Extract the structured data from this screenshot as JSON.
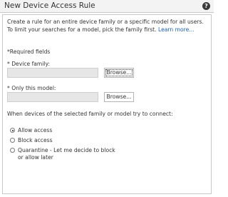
{
  "window": {
    "title": "New Device Access Rule"
  },
  "intro": {
    "text": "Create a rule for an entire device family or a specific model for all users. To limit your searches for a model, pick the family first.",
    "link_text": "Learn more..."
  },
  "form": {
    "required_note": "*Required fields",
    "device_family_label": "* Device family:",
    "device_family_value": "",
    "only_model_label": "* Only this model:",
    "only_model_value": "",
    "browse_label": "Browse...",
    "connect_question": "When devices of the selected family or model try to connect:",
    "options": [
      {
        "label": "Allow access",
        "checked": true
      },
      {
        "label": "Block access",
        "checked": false
      },
      {
        "label": "Quarantine - Let me decide to block or allow later",
        "checked": false
      }
    ]
  },
  "icons": {
    "help": "help-icon"
  },
  "colors": {
    "link": "#1a5fb4",
    "field_bg": "#e6e6e6"
  }
}
